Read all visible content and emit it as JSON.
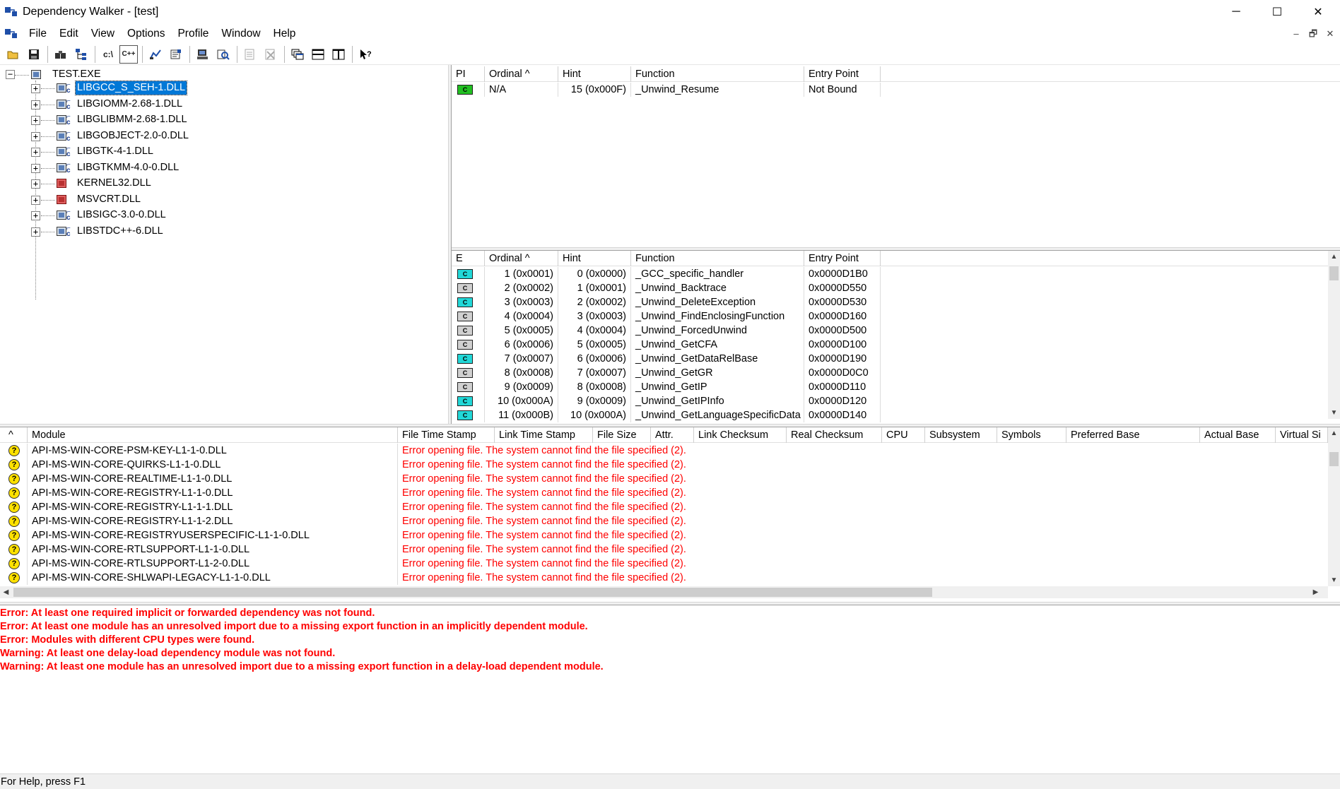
{
  "window": {
    "title": "Dependency Walker - [test]",
    "minimize": "─",
    "maximize": "☐",
    "close": "✕"
  },
  "menu": {
    "items": [
      "File",
      "Edit",
      "View",
      "Options",
      "Profile",
      "Window",
      "Help"
    ],
    "mdi_minimize": "–",
    "mdi_restore": "🗗",
    "mdi_close": "✕"
  },
  "toolbar": {
    "buttons": [
      {
        "icon": "open-folder-icon"
      },
      {
        "icon": "save-icon"
      },
      {
        "icon": "find-icon"
      },
      {
        "icon": "dependency-tree-icon"
      },
      {
        "icon": "full-paths-icon",
        "label": "c:\\"
      },
      {
        "icon": "undecorate-cpp-icon",
        "label": "C++"
      },
      {
        "icon": "auto-expand-icon"
      },
      {
        "icon": "properties-icon"
      },
      {
        "icon": "system-info-icon"
      },
      {
        "icon": "view-full-icon"
      },
      {
        "icon": "next-module-icon"
      },
      {
        "icon": "clear-highlight-icon"
      },
      {
        "icon": "cascade-icon"
      },
      {
        "icon": "tile-horizontal-icon"
      },
      {
        "icon": "tile-vertical-icon"
      },
      {
        "icon": "context-help-icon"
      }
    ]
  },
  "tree": {
    "root": "TEST.EXE",
    "root_expander": "−",
    "children": [
      {
        "label": "LIBGCC_S_SEH-1.DLL",
        "icon": "module-icon",
        "selected": true
      },
      {
        "label": "LIBGIOMM-2.68-1.DLL",
        "icon": "module-icon"
      },
      {
        "label": "LIBGLIBMM-2.68-1.DLL",
        "icon": "module-icon"
      },
      {
        "label": "LIBGOBJECT-2.0-0.DLL",
        "icon": "module-icon"
      },
      {
        "label": "LIBGTK-4-1.DLL",
        "icon": "module-icon"
      },
      {
        "label": "LIBGTKMM-4.0-0.DLL",
        "icon": "module-icon"
      },
      {
        "label": "KERNEL32.DLL",
        "icon": "module-missing-icon"
      },
      {
        "label": "MSVCRT.DLL",
        "icon": "module-missing-icon"
      },
      {
        "label": "LIBSIGC-3.0-0.DLL",
        "icon": "module-icon"
      },
      {
        "label": "LIBSTDC++-6.DLL",
        "icon": "module-icon"
      }
    ],
    "expander": "+"
  },
  "imports": {
    "headers": [
      "PI",
      "Ordinal ^",
      "Hint",
      "Function",
      "Entry Point"
    ],
    "rows": [
      {
        "badge": "C",
        "color": "green",
        "ordinal": "N/A",
        "hint": "15 (0x000F)",
        "function": "_Unwind_Resume",
        "entry": "Not Bound"
      }
    ]
  },
  "exports": {
    "headers": [
      "E",
      "Ordinal ^",
      "Hint",
      "Function",
      "Entry Point"
    ],
    "rows": [
      {
        "badge": "C",
        "color": "cyan",
        "ordinal": "1 (0x0001)",
        "hint": "0 (0x0000)",
        "function": "_GCC_specific_handler",
        "entry": "0x0000D1B0"
      },
      {
        "badge": "C",
        "color": "gray",
        "ordinal": "2 (0x0002)",
        "hint": "1 (0x0001)",
        "function": "_Unwind_Backtrace",
        "entry": "0x0000D550"
      },
      {
        "badge": "C",
        "color": "cyan",
        "ordinal": "3 (0x0003)",
        "hint": "2 (0x0002)",
        "function": "_Unwind_DeleteException",
        "entry": "0x0000D530"
      },
      {
        "badge": "C",
        "color": "gray",
        "ordinal": "4 (0x0004)",
        "hint": "3 (0x0003)",
        "function": "_Unwind_FindEnclosingFunction",
        "entry": "0x0000D160"
      },
      {
        "badge": "C",
        "color": "gray",
        "ordinal": "5 (0x0005)",
        "hint": "4 (0x0004)",
        "function": "_Unwind_ForcedUnwind",
        "entry": "0x0000D500"
      },
      {
        "badge": "C",
        "color": "gray",
        "ordinal": "6 (0x0006)",
        "hint": "5 (0x0005)",
        "function": "_Unwind_GetCFA",
        "entry": "0x0000D100"
      },
      {
        "badge": "C",
        "color": "cyan",
        "ordinal": "7 (0x0007)",
        "hint": "6 (0x0006)",
        "function": "_Unwind_GetDataRelBase",
        "entry": "0x0000D190"
      },
      {
        "badge": "C",
        "color": "gray",
        "ordinal": "8 (0x0008)",
        "hint": "7 (0x0007)",
        "function": "_Unwind_GetGR",
        "entry": "0x0000D0C0"
      },
      {
        "badge": "C",
        "color": "gray",
        "ordinal": "9 (0x0009)",
        "hint": "8 (0x0008)",
        "function": "_Unwind_GetIP",
        "entry": "0x0000D110"
      },
      {
        "badge": "C",
        "color": "cyan",
        "ordinal": "10 (0x000A)",
        "hint": "9 (0x0009)",
        "function": "_Unwind_GetIPInfo",
        "entry": "0x0000D120"
      },
      {
        "badge": "C",
        "color": "cyan",
        "ordinal": "11 (0x000B)",
        "hint": "10 (0x000A)",
        "function": "_Unwind_GetLanguageSpecificData",
        "entry": "0x0000D140"
      }
    ]
  },
  "modules": {
    "headers": [
      "^",
      "Module",
      "File Time Stamp",
      "Link Time Stamp",
      "File Size",
      "Attr.",
      "Link Checksum",
      "Real Checksum",
      "CPU",
      "Subsystem",
      "Symbols",
      "Preferred Base",
      "Actual Base",
      "Virtual Si"
    ],
    "rows": [
      {
        "name": "API-MS-WIN-CORE-PSM-KEY-L1-1-0.DLL",
        "error": "Error opening file. The system cannot find the file specified (2)."
      },
      {
        "name": "API-MS-WIN-CORE-QUIRKS-L1-1-0.DLL",
        "error": "Error opening file. The system cannot find the file specified (2)."
      },
      {
        "name": "API-MS-WIN-CORE-REALTIME-L1-1-0.DLL",
        "error": "Error opening file. The system cannot find the file specified (2)."
      },
      {
        "name": "API-MS-WIN-CORE-REGISTRY-L1-1-0.DLL",
        "error": "Error opening file. The system cannot find the file specified (2)."
      },
      {
        "name": "API-MS-WIN-CORE-REGISTRY-L1-1-1.DLL",
        "error": "Error opening file. The system cannot find the file specified (2)."
      },
      {
        "name": "API-MS-WIN-CORE-REGISTRY-L1-1-2.DLL",
        "error": "Error opening file. The system cannot find the file specified (2)."
      },
      {
        "name": "API-MS-WIN-CORE-REGISTRYUSERSPECIFIC-L1-1-0.DLL",
        "error": "Error opening file. The system cannot find the file specified (2)."
      },
      {
        "name": "API-MS-WIN-CORE-RTLSUPPORT-L1-1-0.DLL",
        "error": "Error opening file. The system cannot find the file specified (2)."
      },
      {
        "name": "API-MS-WIN-CORE-RTLSUPPORT-L1-2-0.DLL",
        "error": "Error opening file. The system cannot find the file specified (2)."
      },
      {
        "name": "API-MS-WIN-CORE-SHLWAPI-LEGACY-L1-1-0.DLL",
        "error": "Error opening file. The system cannot find the file specified (2)."
      }
    ],
    "status_icon": "?"
  },
  "log": [
    "Error: At least one required implicit or forwarded dependency was not found.",
    "Error: At least one module has an unresolved import due to a missing export function in an implicitly dependent module.",
    "Error: Modules with different CPU types were found.",
    "Warning: At least one delay-load dependency module was not found.",
    "Warning: At least one module has an unresolved import due to a missing export function in a delay-load dependent module."
  ],
  "status": "For Help, press F1",
  "colors": {
    "error": "#ff0000",
    "selection": "#0078d7",
    "export_cyan": "#22d8d8",
    "import_green": "#22c022"
  }
}
